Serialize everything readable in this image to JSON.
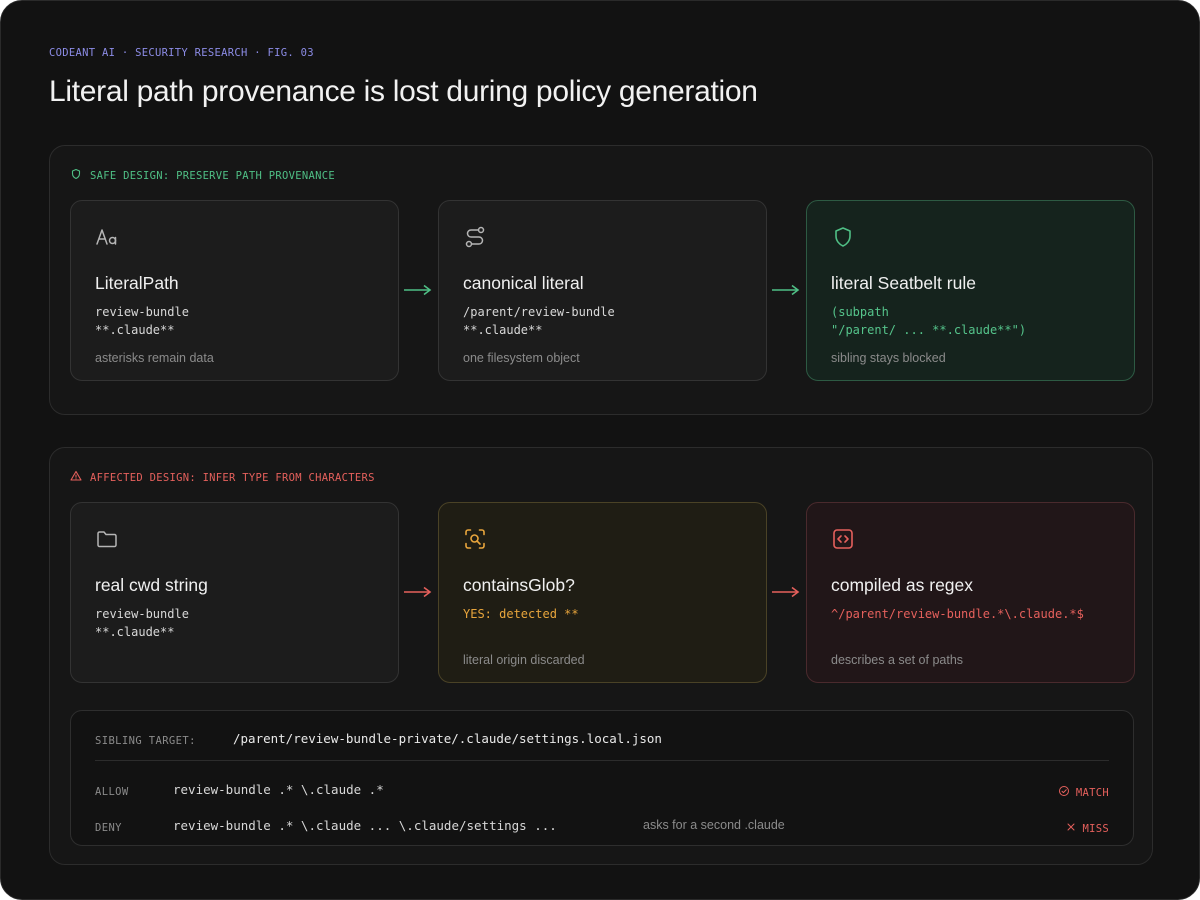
{
  "header": {
    "eyebrow": "CODEANT AI · SECURITY RESEARCH · FIG. 03",
    "title": "Literal path provenance is lost during policy generation"
  },
  "safe": {
    "label": "SAFE DESIGN: PRESERVE PATH PROVENANCE",
    "color": "#4fbf85",
    "cards": [
      {
        "icon": "font-icon",
        "title": "LiteralPath",
        "code": "review-bundle\n**.claude**",
        "note": "asterisks remain data"
      },
      {
        "icon": "route-icon",
        "title": "canonical literal",
        "code": "/parent/review-bundle\n**.claude**",
        "note": "one filesystem object"
      },
      {
        "icon": "shield-icon",
        "title": "literal Seatbelt rule",
        "code": "(subpath\n\"/parent/ ... **.claude**\")",
        "note": "sibling stays blocked"
      }
    ]
  },
  "affected": {
    "label": "AFFECTED DESIGN: INFER TYPE FROM CHARACTERS",
    "color": "#e5605c",
    "cards": [
      {
        "icon": "folder-icon",
        "title": "real cwd string",
        "code": "review-bundle\n**.claude**",
        "note": ""
      },
      {
        "icon": "scan-search-icon",
        "title": "containsGlob?",
        "code": "YES: detected **",
        "note": "literal origin discarded"
      },
      {
        "icon": "code-icon",
        "title": "compiled as regex",
        "code": "^/parent/review-bundle.*\\.claude.*$",
        "note": "describes a set of paths"
      }
    ]
  },
  "sibling": {
    "label": "SIBLING TARGET:",
    "path": "/parent/review-bundle-private/.claude/settings.local.json",
    "rows": [
      {
        "label": "ALLOW",
        "expr": "review-bundle .* \\.claude .*",
        "note": "",
        "status": "MATCH",
        "status_icon": "check-circle-icon"
      },
      {
        "label": "DENY",
        "expr": "review-bundle .* \\.claude ... \\.claude/settings ...",
        "note": "asks for a second .claude",
        "status": "MISS",
        "status_icon": "x-icon"
      }
    ]
  },
  "colors": {
    "accent": "#8c8ce6",
    "safe": "#4fbf85",
    "danger": "#e5605c",
    "warning": "#e8a53c"
  }
}
